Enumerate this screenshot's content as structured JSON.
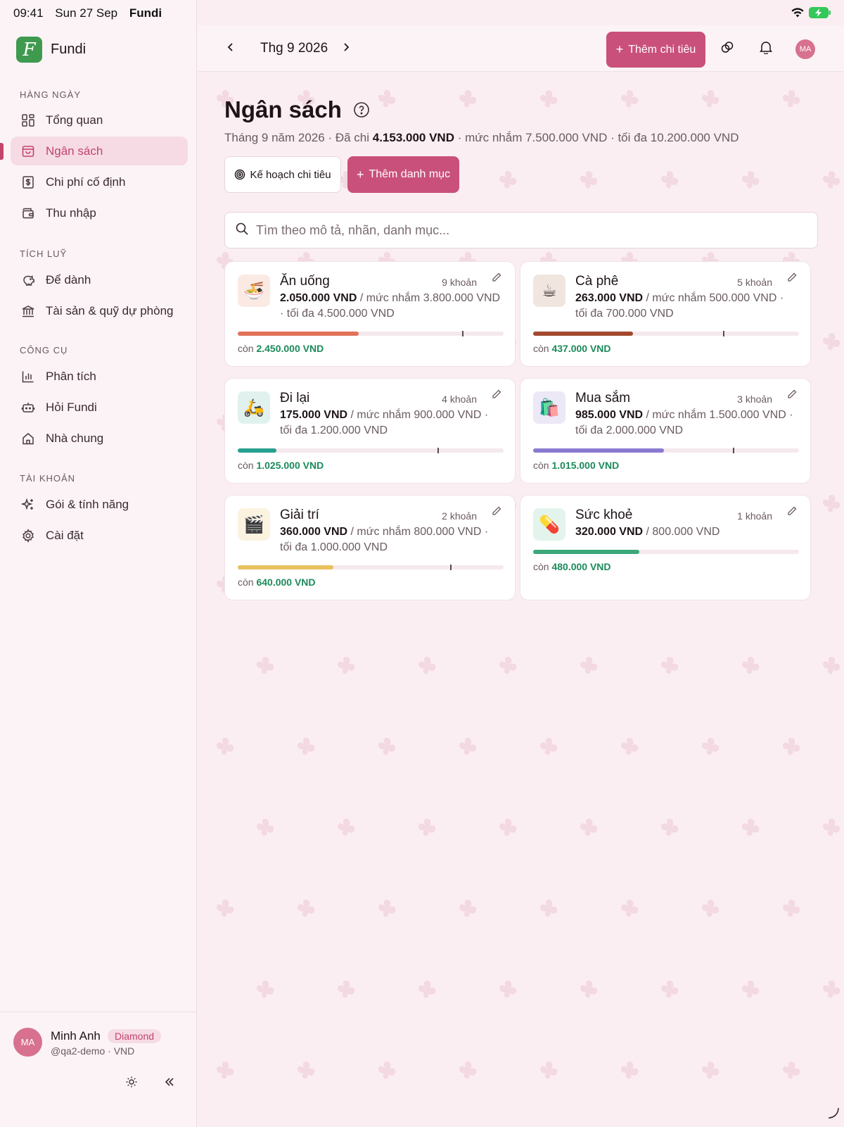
{
  "status": {
    "time": "09:41",
    "date": "Sun 27 Sep",
    "app": "Fundi"
  },
  "brand": {
    "logo_letter": "F",
    "name": "Fundi"
  },
  "nav": {
    "sections": [
      {
        "title": "HÀNG NGÀY",
        "items": [
          {
            "label": "Tổng quan",
            "icon": "dashboard-icon"
          },
          {
            "label": "Ngân sách",
            "icon": "budget-bag-icon",
            "active": true
          },
          {
            "label": "Chi phí cố định",
            "icon": "fixed-cost-icon"
          },
          {
            "label": "Thu nhập",
            "icon": "wallet-icon"
          }
        ]
      },
      {
        "title": "TÍCH LUỸ",
        "items": [
          {
            "label": "Để dành",
            "icon": "piggy-bank-icon"
          },
          {
            "label": "Tài sản & quỹ dự phòng",
            "icon": "bank-icon"
          }
        ]
      },
      {
        "title": "CÔNG CỤ",
        "items": [
          {
            "label": "Phân tích",
            "icon": "bar-chart-icon"
          },
          {
            "label": "Hỏi Fundi",
            "icon": "bot-icon"
          },
          {
            "label": "Nhà chung",
            "icon": "home-icon"
          }
        ]
      },
      {
        "title": "TÀI KHOẢN",
        "items": [
          {
            "label": "Gói & tính năng",
            "icon": "sparkles-icon"
          },
          {
            "label": "Cài đặt",
            "icon": "gear-icon"
          }
        ]
      }
    ]
  },
  "user": {
    "initials": "MA",
    "name": "Minh Anh",
    "badge": "Diamond",
    "sub": "@qa2-demo · VND"
  },
  "header": {
    "month": "Thg 9 2026",
    "add_expense": "Thêm chi tiêu",
    "avatar": "MA"
  },
  "page": {
    "title": "Ngân sách",
    "summary_prefix": "Tháng 9 năm 2026 · Đã chi ",
    "summary_spent": "4.153.000 VND",
    "summary_suffix": " · mức nhắm 7.500.000 VND · tối đa 10.200.000 VND",
    "plan_button": "Kế hoạch chi tiêu",
    "add_category_button": "Thêm danh mục",
    "search_placeholder": "Tìm theo mô tả, nhãn, danh mục..."
  },
  "categories": [
    {
      "emoji": "🍜",
      "name": "Ăn uống",
      "count": "9 khoản",
      "spent": "2.050.000 VND",
      "detail": " / mức nhắm 3.800.000 VND · tối đa 4.500.000 VND",
      "remain_label": "còn ",
      "remain": "2.450.000 VND",
      "color": "#e0725a",
      "emoji_bg": "#fbeae4",
      "progress": 0.456,
      "target_ratio": 0.844
    },
    {
      "emoji": "☕",
      "name": "Cà phê",
      "count": "5 khoản",
      "spent": "263.000 VND",
      "detail": " / mức nhắm 500.000 VND · tối đa 700.000 VND",
      "remain_label": "còn ",
      "remain": "437.000 VND",
      "color": "#a2492e",
      "emoji_bg": "#f1e6df",
      "progress": 0.376,
      "target_ratio": 0.714
    },
    {
      "emoji": "🛵",
      "name": "Đi lại",
      "count": "4 khoản",
      "spent": "175.000 VND",
      "detail": " / mức nhắm 900.000 VND · tối đa 1.200.000 VND",
      "remain_label": "còn ",
      "remain": "1.025.000 VND",
      "color": "#28a090",
      "emoji_bg": "#e1f2ee",
      "progress": 0.146,
      "target_ratio": 0.75
    },
    {
      "emoji": "🛍️",
      "name": "Mua sắm",
      "count": "3 khoản",
      "spent": "985.000 VND",
      "detail": " / mức nhắm 1.500.000 VND · tối đa 2.000.000 VND",
      "remain_label": "còn ",
      "remain": "1.015.000 VND",
      "color": "#8a7ad0",
      "emoji_bg": "#ece8f6",
      "progress": 0.493,
      "target_ratio": 0.75
    },
    {
      "emoji": "🎬",
      "name": "Giải trí",
      "count": "2 khoản",
      "spent": "360.000 VND",
      "detail": " / mức nhắm 800.000 VND · tối đa 1.000.000 VND",
      "remain_label": "còn ",
      "remain": "640.000 VND",
      "color": "#e8c05e",
      "emoji_bg": "#fbf3df",
      "progress": 0.36,
      "target_ratio": 0.8
    },
    {
      "emoji": "💊",
      "name": "Sức khoẻ",
      "count": "1 khoản",
      "spent": "320.000 VND",
      "detail": " / 800.000 VND",
      "remain_label": "còn ",
      "remain": "480.000 VND",
      "color": "#3aa87a",
      "emoji_bg": "#e3f4ec",
      "progress": 0.4
    }
  ]
}
